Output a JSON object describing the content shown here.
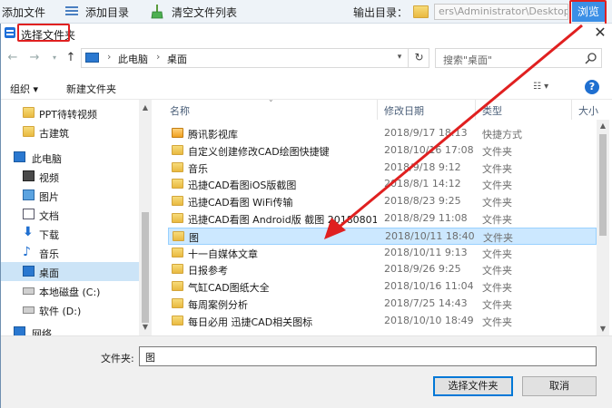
{
  "app_toolbar": {
    "add_file": "添加文件",
    "add_dir": "添加目录",
    "clear_list": "清空文件列表",
    "output_dir_label": "输出目录：",
    "output_path": "ers\\Administrator\\Desktop",
    "browse": "浏览"
  },
  "dialog": {
    "title": "选择文件夹",
    "breadcrumb": [
      "此电脑",
      "桌面"
    ],
    "search_placeholder": "搜索\"桌面\"",
    "organize": "组织 ▾",
    "new_folder": "新建文件夹",
    "help": "?",
    "sidebar": [
      {
        "label": "PPT待转视频",
        "icon": "folder-icon"
      },
      {
        "label": "古建筑",
        "icon": "folder-icon"
      },
      {
        "label": "此电脑",
        "icon": "computer-icon"
      },
      {
        "label": "视频",
        "icon": "video-icon"
      },
      {
        "label": "图片",
        "icon": "picture-icon"
      },
      {
        "label": "文档",
        "icon": "document-icon"
      },
      {
        "label": "下载",
        "icon": "download-icon"
      },
      {
        "label": "音乐",
        "icon": "music-icon"
      },
      {
        "label": "桌面",
        "icon": "desktop-icon",
        "selected": true
      },
      {
        "label": "本地磁盘 (C:)",
        "icon": "drive-icon"
      },
      {
        "label": "软件 (D:)",
        "icon": "drive-icon"
      },
      {
        "label": "网络",
        "icon": "network-icon"
      }
    ],
    "columns": {
      "name": "名称",
      "date": "修改日期",
      "type": "类型",
      "size": "大小"
    },
    "files": [
      {
        "name": "腾讯影视库",
        "date": "2018/9/17 18:13",
        "type": "快捷方式",
        "icon": "shortcut-icon"
      },
      {
        "name": "自定义创建修改CAD绘图快捷键",
        "date": "2018/10/16 17:08",
        "type": "文件夹",
        "icon": "folder-icon"
      },
      {
        "name": "音乐",
        "date": "2018/9/18 9:12",
        "type": "文件夹",
        "icon": "folder-icon"
      },
      {
        "name": "迅捷CAD看图iOS版截图",
        "date": "2018/8/1 14:12",
        "type": "文件夹",
        "icon": "folder-icon"
      },
      {
        "name": "迅捷CAD看图 WiFi传输",
        "date": "2018/8/23 9:25",
        "type": "文件夹",
        "icon": "folder-icon"
      },
      {
        "name": "迅捷CAD看图 Android版 截图 20180801",
        "date": "2018/8/29 11:08",
        "type": "文件夹",
        "icon": "folder-icon"
      },
      {
        "name": "图",
        "date": "2018/10/11 18:40",
        "type": "文件夹",
        "icon": "folder-icon",
        "selected": true
      },
      {
        "name": "十一自媒体文章",
        "date": "2018/10/11 9:13",
        "type": "文件夹",
        "icon": "folder-icon"
      },
      {
        "name": "日报参考",
        "date": "2018/9/26 9:25",
        "type": "文件夹",
        "icon": "folder-icon"
      },
      {
        "name": "气缸CAD图纸大全",
        "date": "2018/10/16 11:04",
        "type": "文件夹",
        "icon": "folder-icon"
      },
      {
        "name": "每周案例分析",
        "date": "2018/7/25 14:43",
        "type": "文件夹",
        "icon": "folder-icon"
      },
      {
        "name": "每日必用 迅捷CAD相关图标",
        "date": "2018/10/10 18:49",
        "type": "文件夹",
        "icon": "folder-icon"
      }
    ],
    "folder_label": "文件夹:",
    "folder_value": "图",
    "select_button": "选择文件夹",
    "cancel_button": "取消"
  },
  "colors": {
    "highlight_red": "#e02020",
    "accent_blue": "#3b8fe6",
    "selection": "#cce8ff"
  }
}
